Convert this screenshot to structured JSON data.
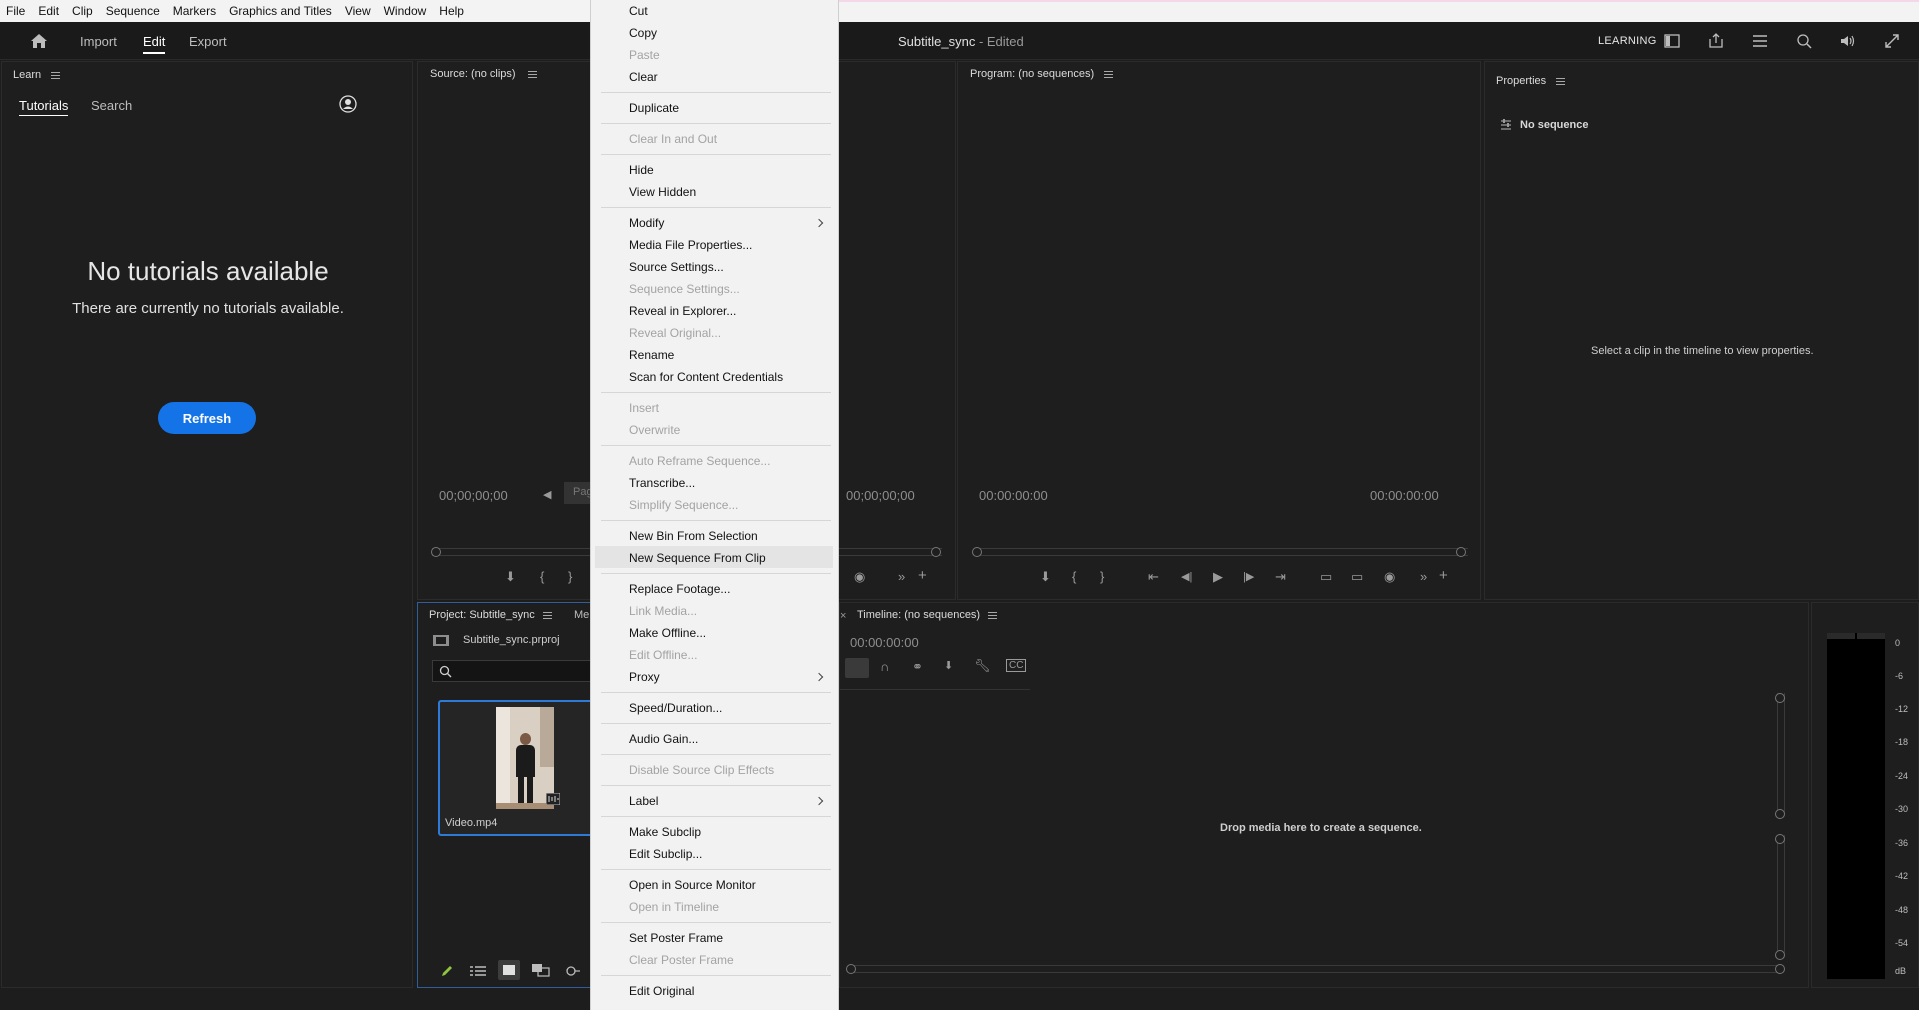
{
  "menubar": [
    "File",
    "Edit",
    "Clip",
    "Sequence",
    "Markers",
    "Graphics and Titles",
    "View",
    "Window",
    "Help"
  ],
  "header": {
    "workspaces": [
      "Import",
      "Edit",
      "Export"
    ],
    "title": "Subtitle_sync",
    "title_suffix": " - Edited",
    "learning_label": "LEARNING"
  },
  "learn_panel": {
    "tab": "Learn",
    "tabs": [
      "Tutorials",
      "Search"
    ],
    "heading": "No tutorials available",
    "message": "There are currently no tutorials available.",
    "refresh_label": "Refresh"
  },
  "source_panel": {
    "tab": "Source: (no clips)",
    "timecode_left": "00;00;00;00",
    "timecode_right": "00;00;00;00",
    "page_label": "Pag"
  },
  "program_panel": {
    "tab": "Program: (no sequences)",
    "timecode_left": "00:00:00:00",
    "timecode_right": "00:00:00:00"
  },
  "properties_panel": {
    "tab": "Properties",
    "no_sequence": "No sequence",
    "hint": "Select a clip in the timeline to view properties."
  },
  "project_panel": {
    "tab": "Project: Subtitle_sync",
    "second_tab": "Me",
    "project_file": "Subtitle_sync.prproj",
    "clip_name": "Video.mp4"
  },
  "timeline_panel": {
    "tab": "Timeline: (no sequences)",
    "timecode": "00:00:00:00",
    "drop_hint": "Drop media here to create a sequence."
  },
  "audio_meter": {
    "labels": [
      "0",
      "-6",
      "-12",
      "-18",
      "-24",
      "-30",
      "-36",
      "-42",
      "-48",
      "-54",
      "dB"
    ]
  },
  "context_menu": {
    "items": [
      {
        "label": "Cut",
        "disabled": false
      },
      {
        "label": "Copy",
        "disabled": false
      },
      {
        "label": "Paste",
        "disabled": true
      },
      {
        "label": "Clear",
        "disabled": false
      },
      {
        "label": "Duplicate",
        "disabled": false
      },
      {
        "label": "Clear In and Out",
        "disabled": true
      },
      {
        "label": "Hide",
        "disabled": false
      },
      {
        "label": "View Hidden",
        "disabled": false
      },
      {
        "label": "Modify",
        "disabled": false,
        "submenu": true
      },
      {
        "label": "Media File Properties...",
        "disabled": false
      },
      {
        "label": "Source Settings...",
        "disabled": false
      },
      {
        "label": "Sequence Settings...",
        "disabled": true
      },
      {
        "label": "Reveal in Explorer...",
        "disabled": false
      },
      {
        "label": "Reveal Original...",
        "disabled": true
      },
      {
        "label": "Rename",
        "disabled": false
      },
      {
        "label": "Scan for Content Credentials",
        "disabled": false
      },
      {
        "label": "Insert",
        "disabled": true
      },
      {
        "label": "Overwrite",
        "disabled": true
      },
      {
        "label": "Auto Reframe Sequence...",
        "disabled": true
      },
      {
        "label": "Transcribe...",
        "disabled": false
      },
      {
        "label": "Simplify Sequence...",
        "disabled": true
      },
      {
        "label": "New Bin From Selection",
        "disabled": false
      },
      {
        "label": "New Sequence From Clip",
        "disabled": false,
        "highlighted": true
      },
      {
        "label": "Replace Footage...",
        "disabled": false
      },
      {
        "label": "Link Media...",
        "disabled": true
      },
      {
        "label": "Make Offline...",
        "disabled": false
      },
      {
        "label": "Edit Offline...",
        "disabled": true
      },
      {
        "label": "Proxy",
        "disabled": false,
        "submenu": true
      },
      {
        "label": "Speed/Duration...",
        "disabled": false
      },
      {
        "label": "Audio Gain...",
        "disabled": false
      },
      {
        "label": "Disable Source Clip Effects",
        "disabled": true
      },
      {
        "label": "Label",
        "disabled": false,
        "submenu": true
      },
      {
        "label": "Make Subclip",
        "disabled": false
      },
      {
        "label": "Edit Subclip...",
        "disabled": false
      },
      {
        "label": "Open in Source Monitor",
        "disabled": false
      },
      {
        "label": "Open in Timeline",
        "disabled": true
      },
      {
        "label": "Set Poster Frame",
        "disabled": false
      },
      {
        "label": "Clear Poster Frame",
        "disabled": true
      },
      {
        "label": "Edit Original",
        "disabled": false
      }
    ]
  }
}
